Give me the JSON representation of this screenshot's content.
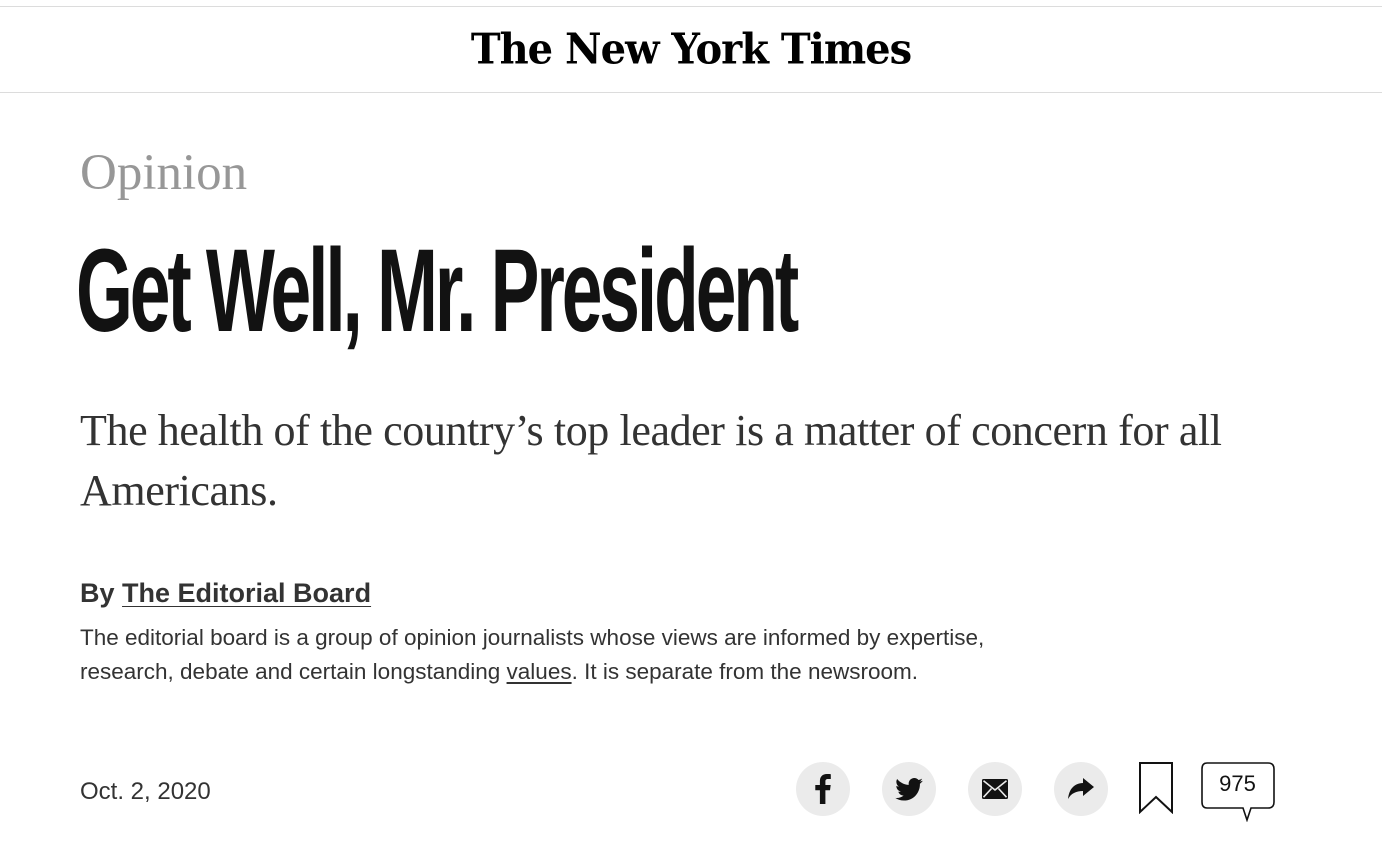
{
  "masthead": {
    "logo_text": "The New York Times"
  },
  "article": {
    "kicker": "Opinion",
    "headline": "Get Well, Mr. President",
    "summary": "The health of the country’s top leader is a matter of concern for all Americans.",
    "byline_prefix": "By",
    "byline_author": "The Editorial Board",
    "bio_before_link": "The editorial board is a group of opinion journalists whose views are informed by expertise, research, debate and certain longstanding ",
    "bio_link": "values",
    "bio_after_link": ". It is separate from the newsroom.",
    "date": "Oct. 2, 2020"
  },
  "toolbar": {
    "facebook_icon": "facebook-icon",
    "twitter_icon": "twitter-icon",
    "email_icon": "email-icon",
    "share_icon": "share-arrow-icon",
    "bookmark_icon": "bookmark-icon",
    "comment_count": "975"
  },
  "colors": {
    "text": "#121212",
    "kicker": "#979797",
    "button_bg": "#ebebeb",
    "rule": "#dcdcdc"
  }
}
